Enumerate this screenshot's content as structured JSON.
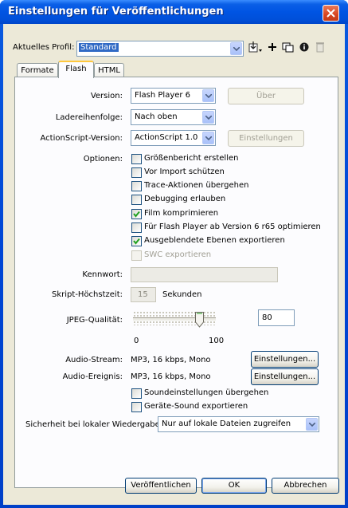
{
  "window": {
    "title": "Einstellungen für Veröffentlichungen"
  },
  "profile": {
    "label": "Aktuelles Profil:",
    "value": "Standard"
  },
  "tabs": [
    {
      "label": "Formate"
    },
    {
      "label": "Flash"
    },
    {
      "label": "HTML"
    }
  ],
  "version": {
    "label": "Version:",
    "value": "Flash Player 6",
    "button": "Über"
  },
  "load_order": {
    "label": "Ladereihenfolge:",
    "value": "Nach oben"
  },
  "actionscript": {
    "label": "ActionScript-Version:",
    "value": "ActionScript 1.0",
    "button": "Einstellungen"
  },
  "options": {
    "label": "Optionen:",
    "items": [
      {
        "label": "Größenbericht erstellen",
        "checked": false,
        "enabled": true
      },
      {
        "label": "Vor Import schützen",
        "checked": false,
        "enabled": true
      },
      {
        "label": "Trace-Aktionen übergehen",
        "checked": false,
        "enabled": true
      },
      {
        "label": "Debugging erlauben",
        "checked": false,
        "enabled": true
      },
      {
        "label": "Film komprimieren",
        "checked": true,
        "enabled": true
      },
      {
        "label": "Für Flash Player ab Version 6 r65 optimieren",
        "checked": false,
        "enabled": true
      },
      {
        "label": "Ausgeblendete Ebenen exportieren",
        "checked": true,
        "enabled": true
      },
      {
        "label": "SWC exportieren",
        "checked": false,
        "enabled": false
      }
    ]
  },
  "password": {
    "label": "Kennwort:",
    "value": ""
  },
  "script_timeout": {
    "label": "Skript-Höchstzeit:",
    "value": "15",
    "unit": "Sekunden"
  },
  "jpeg": {
    "label": "JPEG-Qualität:",
    "value": "80",
    "min_label": "0",
    "max_label": "100",
    "level": 80
  },
  "audio_stream": {
    "label": "Audio-Stream:",
    "value": "MP3, 16 kbps, Mono",
    "button": "Einstellungen..."
  },
  "audio_event": {
    "label": "Audio-Ereignis:",
    "value": "MP3, 16 kbps, Mono",
    "button": "Einstellungen..."
  },
  "sound": {
    "override": {
      "label": "Soundeinstellungen übergehen",
      "checked": false
    },
    "device": {
      "label": "Geräte-Sound exportieren",
      "checked": false
    }
  },
  "local_security": {
    "label": "Sicherheit bei lokaler Wiedergabe:",
    "value": "Nur auf lokale Dateien zugreifen"
  },
  "footer": {
    "publish": "Veröffentlichen",
    "ok": "OK",
    "cancel": "Abbrechen"
  },
  "colors": {
    "titlebar": "#0054e3",
    "client": "#ece9d8",
    "selection": "#316ac5",
    "close": "#d8451f"
  }
}
